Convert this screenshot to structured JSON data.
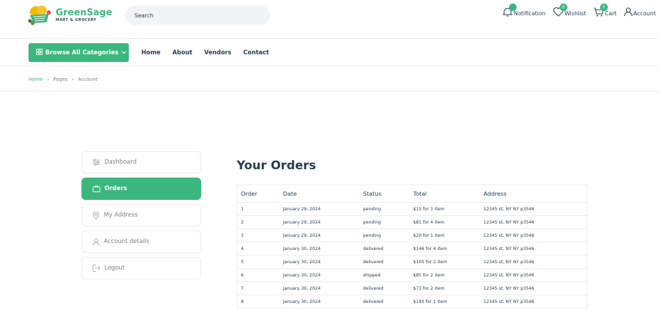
{
  "brand": {
    "name": "GreenSage",
    "tagline": "MART & GROCERY"
  },
  "search": {
    "placeholder": "Search"
  },
  "header_actions": {
    "notification": {
      "label": "Notification",
      "count": ""
    },
    "wishlist": {
      "label": "Wishlist",
      "count": "0"
    },
    "cart": {
      "label": "Cart",
      "count": "0"
    },
    "account": {
      "label": "Account"
    }
  },
  "nav": {
    "browse_label": "Browse All Categories",
    "links": [
      "Home",
      "About",
      "Vendors",
      "Contact"
    ]
  },
  "breadcrumb": [
    "Home",
    "Pages",
    "Account"
  ],
  "sidebar": {
    "items": [
      {
        "label": "Dashboard",
        "icon": "sliders-icon",
        "active": false
      },
      {
        "label": "Orders",
        "icon": "bag-icon",
        "active": true
      },
      {
        "label": "My Address",
        "icon": "location-pin-icon",
        "active": false
      },
      {
        "label": "Account details",
        "icon": "user-icon",
        "active": false
      },
      {
        "label": "Logout",
        "icon": "logout-icon",
        "active": false
      }
    ]
  },
  "orders": {
    "title": "Your Orders",
    "columns": [
      "Order",
      "Date",
      "Status",
      "Total",
      "Address"
    ],
    "rows": [
      [
        "1",
        "January 29, 2024",
        "pending",
        "$15 for 1 item",
        "12345 st, NY NY p3546"
      ],
      [
        "2",
        "January 29, 2024",
        "pending",
        "$81 for 4 item",
        "12345 st, NY NY p3546"
      ],
      [
        "3",
        "January 29, 2024",
        "pending",
        "$20 for 1 item",
        "12345 st, NY NY p3546"
      ],
      [
        "4",
        "January 30, 2024",
        "delivered",
        "$146 for 4 item",
        "12345 st, NY NY p3546"
      ],
      [
        "5",
        "January 30, 2024",
        "delivered",
        "$105 for 2 item",
        "12345 st, NY NY p3546"
      ],
      [
        "6",
        "January 30, 2024",
        "shipped",
        "$85 for 2 item",
        "12345 st, NY NY p3546"
      ],
      [
        "7",
        "January 30, 2024",
        "delivered",
        "$73 for 2 item",
        "12345 st, NY NY p3546"
      ],
      [
        "8",
        "January 30, 2024",
        "delivered",
        "$190 for 1 item",
        "12345 st, NY NY p3546"
      ]
    ]
  },
  "colors": {
    "accent": "#3bb77e",
    "text": "#253d4e",
    "muted": "#7e7e7e",
    "border": "#ececec"
  }
}
